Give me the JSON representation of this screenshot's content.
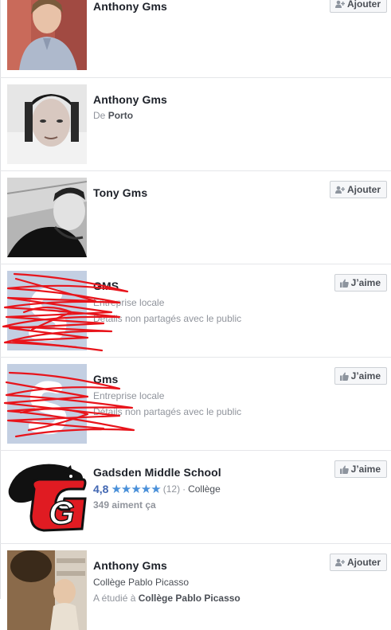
{
  "results": [
    {
      "name": "Anthony Gms",
      "action": "Ajouter"
    },
    {
      "name": "Anthony Gms",
      "sub_prefix": "De ",
      "sub_bold": "Porto"
    },
    {
      "name": "Tony Gms",
      "action": "Ajouter"
    },
    {
      "name": "GMS",
      "line1": "Entreprise locale",
      "line2": "Détails non partagés avec le public",
      "action": "J’aime"
    },
    {
      "name": "Gms",
      "line1": "Entreprise locale",
      "line2": "Détails non partagés avec le public",
      "action": "J’aime"
    },
    {
      "name": "Gadsden Middle School",
      "rating": "4,8",
      "stars": "★★★★★",
      "rating_count": "(12)",
      "separator": "·",
      "category": "Collège",
      "likes": "349 aiment ça",
      "action": "J’aime",
      "logo_letter": "G"
    },
    {
      "name": "Anthony Gms",
      "line1": "Collège Pablo Picasso",
      "studied_prefix": "A étudié à ",
      "studied_bold": "Collège Pablo Picasso",
      "action": "Ajouter"
    }
  ],
  "colors": {
    "link": "#4267b2",
    "star": "#4a90d9",
    "scribble": "#e8141b",
    "placeholder_bg": "#c3cfe2"
  },
  "icons": {
    "add_friend": "add-friend-icon",
    "like": "thumbs-up-icon"
  }
}
